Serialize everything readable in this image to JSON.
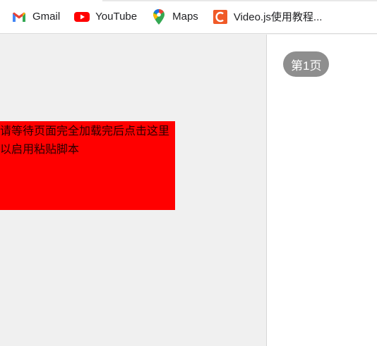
{
  "bookmarks": [
    {
      "label": "Gmail",
      "icon": "gmail-icon"
    },
    {
      "label": "YouTube",
      "icon": "youtube-icon"
    },
    {
      "label": "Maps",
      "icon": "maps-icon"
    },
    {
      "label": "Video.js使用教程...",
      "icon": "c-site-icon"
    }
  ],
  "main": {
    "paste_button_text": "请等待页面完全加载完后点击这里以启用粘贴脚本"
  },
  "side_panel": {
    "page_label": "第1页"
  },
  "colors": {
    "paste_button_bg": "#ff0000",
    "page_badge_bg": "#8e8e8e",
    "youtube_red": "#ff0000",
    "c_icon_orange": "#f05a28"
  }
}
